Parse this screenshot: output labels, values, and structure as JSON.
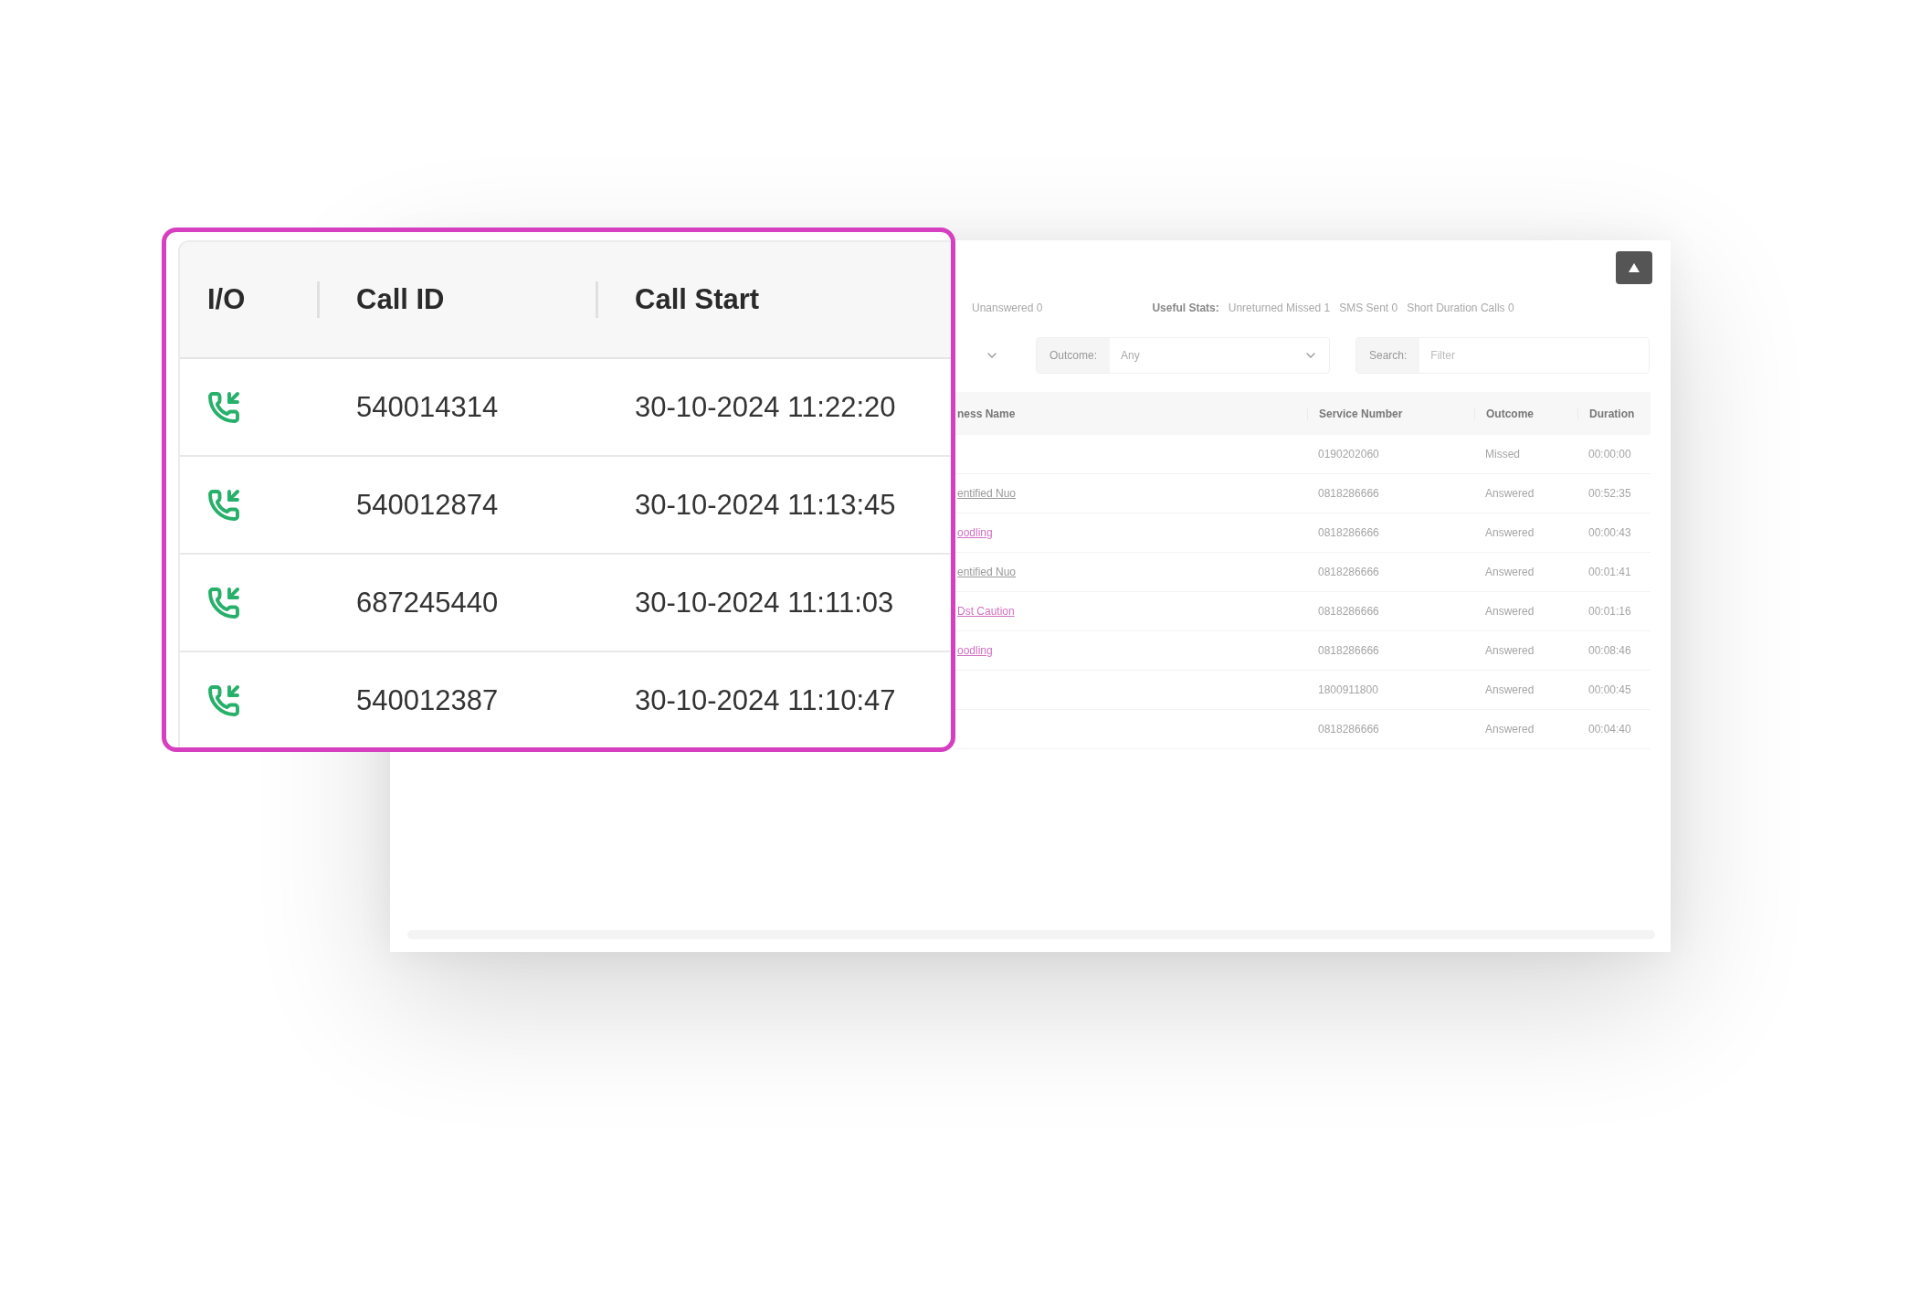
{
  "background_panel": {
    "stats": {
      "unanswered": "Unanswered 0",
      "useful_label": "Useful Stats:",
      "items": [
        "Unreturned Missed 1",
        "SMS Sent 0",
        "Short Duration Calls 0"
      ]
    },
    "filters": {
      "outcome_label": "Outcome:",
      "outcome_value": "Any",
      "search_label": "Search:",
      "search_placeholder": "Filter"
    },
    "table": {
      "columns": [
        "ness Name",
        "Service Number",
        "Outcome",
        "Duration"
      ],
      "rows": [
        {
          "kind": "none",
          "service_number": "0190202060",
          "outcome": "Missed",
          "duration": "00:00:00"
        },
        {
          "kind": "plain",
          "name": "entified Nuo",
          "service_number": "0818286666",
          "outcome": "Answered",
          "duration": "00:52:35"
        },
        {
          "kind": "link",
          "name": "oodling",
          "service_number": "0818286666",
          "outcome": "Answered",
          "duration": "00:00:43"
        },
        {
          "kind": "plain",
          "name": "entified Nuo",
          "service_number": "0818286666",
          "outcome": "Answered",
          "duration": "00:01:41"
        },
        {
          "kind": "link",
          "name": "Dst Caution",
          "service_number": "0818286666",
          "outcome": "Answered",
          "duration": "00:01:16"
        },
        {
          "kind": "link",
          "name": "oodling",
          "service_number": "0818286666",
          "outcome": "Answered",
          "duration": "00:08:46"
        },
        {
          "kind": "none",
          "service_number": "1800911800",
          "outcome": "Answered",
          "duration": "00:00:45"
        },
        {
          "kind": "none",
          "service_number": "0818286666",
          "outcome": "Answered",
          "duration": "00:04:40"
        }
      ]
    }
  },
  "callout": {
    "columns": [
      "I/O",
      "Call ID",
      "Call Start"
    ],
    "rows": [
      {
        "kind": "incoming",
        "call_id": "540014314",
        "call_start": "30-10-2024 11:22:20"
      },
      {
        "kind": "incoming",
        "call_id": "540012874",
        "call_start": "30-10-2024 11:13:45"
      },
      {
        "kind": "incoming",
        "call_id": "687245440",
        "call_start": "30-10-2024 11:11:03"
      },
      {
        "kind": "incoming",
        "call_id": "540012387",
        "call_start": "30-10-2024 11:10:47"
      }
    ]
  }
}
